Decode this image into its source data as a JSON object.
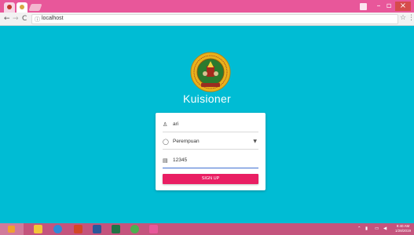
{
  "browser": {
    "address": "localhost",
    "icons": {
      "back": "back-arrow-icon",
      "forward": "forward-arrow-icon",
      "reload": "reload-icon",
      "info": "info-icon",
      "star": "bookmark-star-icon",
      "menu": "menu-dots-icon"
    }
  },
  "page": {
    "background": "#00bcd4",
    "title": "Kuisioner",
    "logo_icon": "university-logo",
    "form": {
      "name_value": "ari",
      "name_icon": "user-icon",
      "gender_value": "Perempuan",
      "gender_icon": "gender-icon",
      "id_value": "12345",
      "id_icon": "id-card-icon",
      "submit_label": "SIGN UP",
      "submit_color": "#e91e63"
    }
  },
  "taskbar": {
    "apps": [
      "file-explorer-icon",
      "chrome-icon",
      "powerpoint-icon",
      "word-icon",
      "excel-icon",
      "chrome-icon",
      "app-icon"
    ],
    "time": "9:40 AM",
    "date": "1/28/2019"
  }
}
